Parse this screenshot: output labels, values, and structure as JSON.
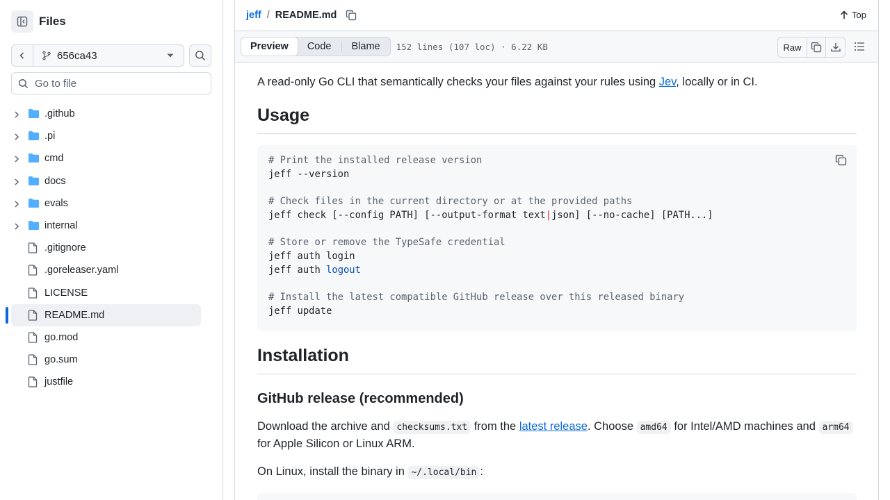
{
  "sidebar": {
    "title": "Files",
    "branch": "656ca43",
    "goto_placeholder": "Go to file",
    "items": [
      {
        "label": ".github",
        "type": "folder"
      },
      {
        "label": ".pi",
        "type": "folder"
      },
      {
        "label": "cmd",
        "type": "folder"
      },
      {
        "label": "docs",
        "type": "folder"
      },
      {
        "label": "evals",
        "type": "folder"
      },
      {
        "label": "internal",
        "type": "folder"
      },
      {
        "label": ".gitignore",
        "type": "file"
      },
      {
        "label": ".goreleaser.yaml",
        "type": "file"
      },
      {
        "label": "LICENSE",
        "type": "file"
      },
      {
        "label": "README.md",
        "type": "file",
        "active": true
      },
      {
        "label": "go.mod",
        "type": "file"
      },
      {
        "label": "go.sum",
        "type": "file"
      },
      {
        "label": "justfile",
        "type": "file"
      }
    ]
  },
  "header": {
    "repo": "jeff",
    "separator": "/",
    "file": "README.md",
    "top_label": "Top"
  },
  "toolbar": {
    "tabs": [
      "Preview",
      "Code",
      "Blame"
    ],
    "active_tab": "Preview",
    "meta": "152 lines (107 loc) · 6.22 KB",
    "raw_label": "Raw"
  },
  "readme": {
    "intro_before": "A read-only Go CLI that semantically checks your files against your rules using ",
    "intro_link": "Jev",
    "intro_after": ", locally or in CI.",
    "usage_heading": "Usage",
    "code": {
      "c1": "# Print the installed release version",
      "l1": "jeff --version",
      "c2": "# Check files in the current directory or at the provided paths",
      "l2a": "jeff check [--config PATH] [--output-format text",
      "l2pipe": "|",
      "l2b": "json] [--no-cache] [PATH...]",
      "c3": "# Store or remove the TypeSafe credential",
      "l3": "jeff auth login",
      "l4a": "jeff auth ",
      "l4b": "logout",
      "c4": "# Install the latest compatible GitHub release over this released binary",
      "l5": "jeff update"
    },
    "installation_heading": "Installation",
    "github_release_heading": "GitHub release (recommended)",
    "download_p": {
      "t1": "Download the archive and ",
      "c1": "checksums.txt",
      "t2": " from the ",
      "link": "latest release",
      "t3": ". Choose ",
      "c2": "amd64",
      "t4": " for Intel/AMD machines and ",
      "c3": "arm64",
      "t5": "for Apple Silicon or Linux ARM."
    },
    "linux_p": {
      "t1": "On Linux, install the binary in ",
      "c1": "~/.local/bin",
      "t2": ":"
    }
  },
  "colors": {
    "accent": "#0969da",
    "border": "#d1d9e0",
    "folder": "#54aeff"
  }
}
